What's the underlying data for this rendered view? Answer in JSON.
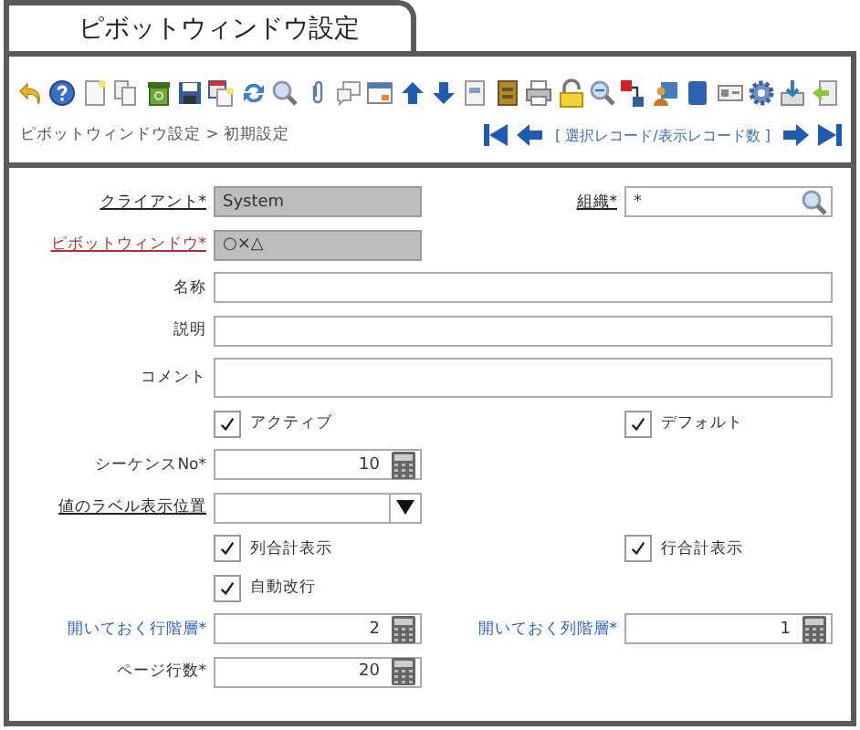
{
  "window": {
    "title": "ピボットウィンドウ設定"
  },
  "breadcrumb": "ピボットウィンドウ設定 > 初期設定",
  "record_nav": {
    "status": "[ 選択レコード/表示レコード数 ]"
  },
  "rows": [
    {
      "cells": [
        {
          "label": {
            "text": "クライアント*",
            "kind": "link"
          },
          "kind": "text",
          "value": "System",
          "readonly": true,
          "full_width": false
        },
        {
          "label": {
            "text": "組織*",
            "kind": "link"
          },
          "kind": "search",
          "value": "*",
          "full_width": false
        }
      ]
    },
    {
      "cells": [
        {
          "label": {
            "text": "ピボットウィンドウ*",
            "kind": "alert"
          },
          "kind": "text",
          "value": "○×△",
          "readonly": true,
          "full_width": false
        }
      ]
    },
    {
      "cells": [
        {
          "label": {
            "text": "名称",
            "kind": "plain"
          },
          "kind": "text",
          "readonly": false,
          "full_width": true
        }
      ]
    },
    {
      "cells": [
        {
          "label": {
            "text": "説明",
            "kind": "plain"
          },
          "kind": "text",
          "readonly": false,
          "full_width": true
        }
      ]
    },
    {
      "cells": [
        {
          "label": {
            "text": "コメント",
            "kind": "plain"
          },
          "kind": "textarea",
          "readonly": false,
          "full_width": true
        }
      ]
    },
    {
      "cells": [
        {
          "kind": "checkbox",
          "text": "アクティブ",
          "checked": true
        },
        {
          "kind": "checkbox",
          "text": "デフォルト",
          "checked": true
        }
      ]
    },
    {
      "cells": [
        {
          "label": {
            "text": "シーケンスNo*",
            "kind": "plain"
          },
          "kind": "number",
          "value": "10",
          "full_width": false
        }
      ]
    },
    {
      "cells": [
        {
          "label": {
            "text": "値のラベル表示位置",
            "kind": "link"
          },
          "kind": "select",
          "full_width": false
        }
      ]
    },
    {
      "cells": [
        {
          "kind": "checkbox",
          "text": "列合計表示",
          "checked": true
        },
        {
          "kind": "checkbox",
          "text": "行合計表示",
          "checked": true
        }
      ]
    },
    {
      "cells": [
        {
          "kind": "checkbox",
          "text": "自動改行",
          "checked": true
        }
      ]
    },
    {
      "cells": [
        {
          "label": {
            "text": "開いておく行階層*",
            "kind": "accent"
          },
          "kind": "number",
          "value": "2",
          "full_width": false
        },
        {
          "label": {
            "text": "開いておく列階層*",
            "kind": "accent"
          },
          "kind": "number",
          "value": "1",
          "full_width": false
        }
      ]
    },
    {
      "cells": [
        {
          "label": {
            "text": "ページ行数*",
            "kind": "plain"
          },
          "kind": "number",
          "value": "20",
          "full_width": false
        }
      ]
    }
  ]
}
